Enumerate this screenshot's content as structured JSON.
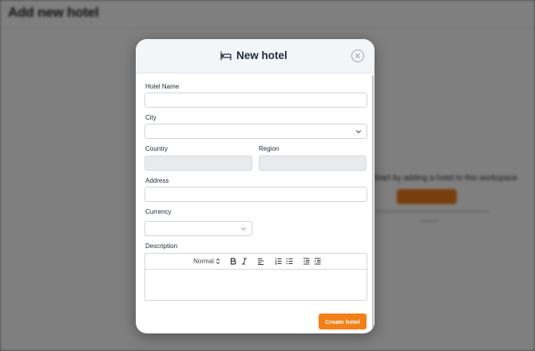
{
  "background": {
    "title": "Add new hotel",
    "empty_text": "Start by adding a hotel to this workspace"
  },
  "modal": {
    "title": "New hotel",
    "fields": {
      "hotel_name": {
        "label": "Hotel Name",
        "value": ""
      },
      "city": {
        "label": "City",
        "value": ""
      },
      "country": {
        "label": "Country",
        "value": ""
      },
      "region": {
        "label": "Region",
        "value": ""
      },
      "address": {
        "label": "Address",
        "value": ""
      },
      "currency": {
        "label": "Currency",
        "value": ""
      },
      "description": {
        "label": "Description"
      }
    },
    "editor_toolbar": {
      "format_select": "Normal"
    },
    "submit_label": "Create hotel"
  },
  "colors": {
    "accent": "#f28017",
    "header_bg": "#f3f6f9",
    "disabled_bg": "#e9eaec"
  },
  "icons": [
    "bed-icon",
    "close-icon",
    "chevron-down-icon",
    "bold-icon",
    "italic-icon",
    "align-left-icon",
    "ordered-list-icon",
    "bullet-list-icon",
    "outdent-icon",
    "indent-icon"
  ]
}
